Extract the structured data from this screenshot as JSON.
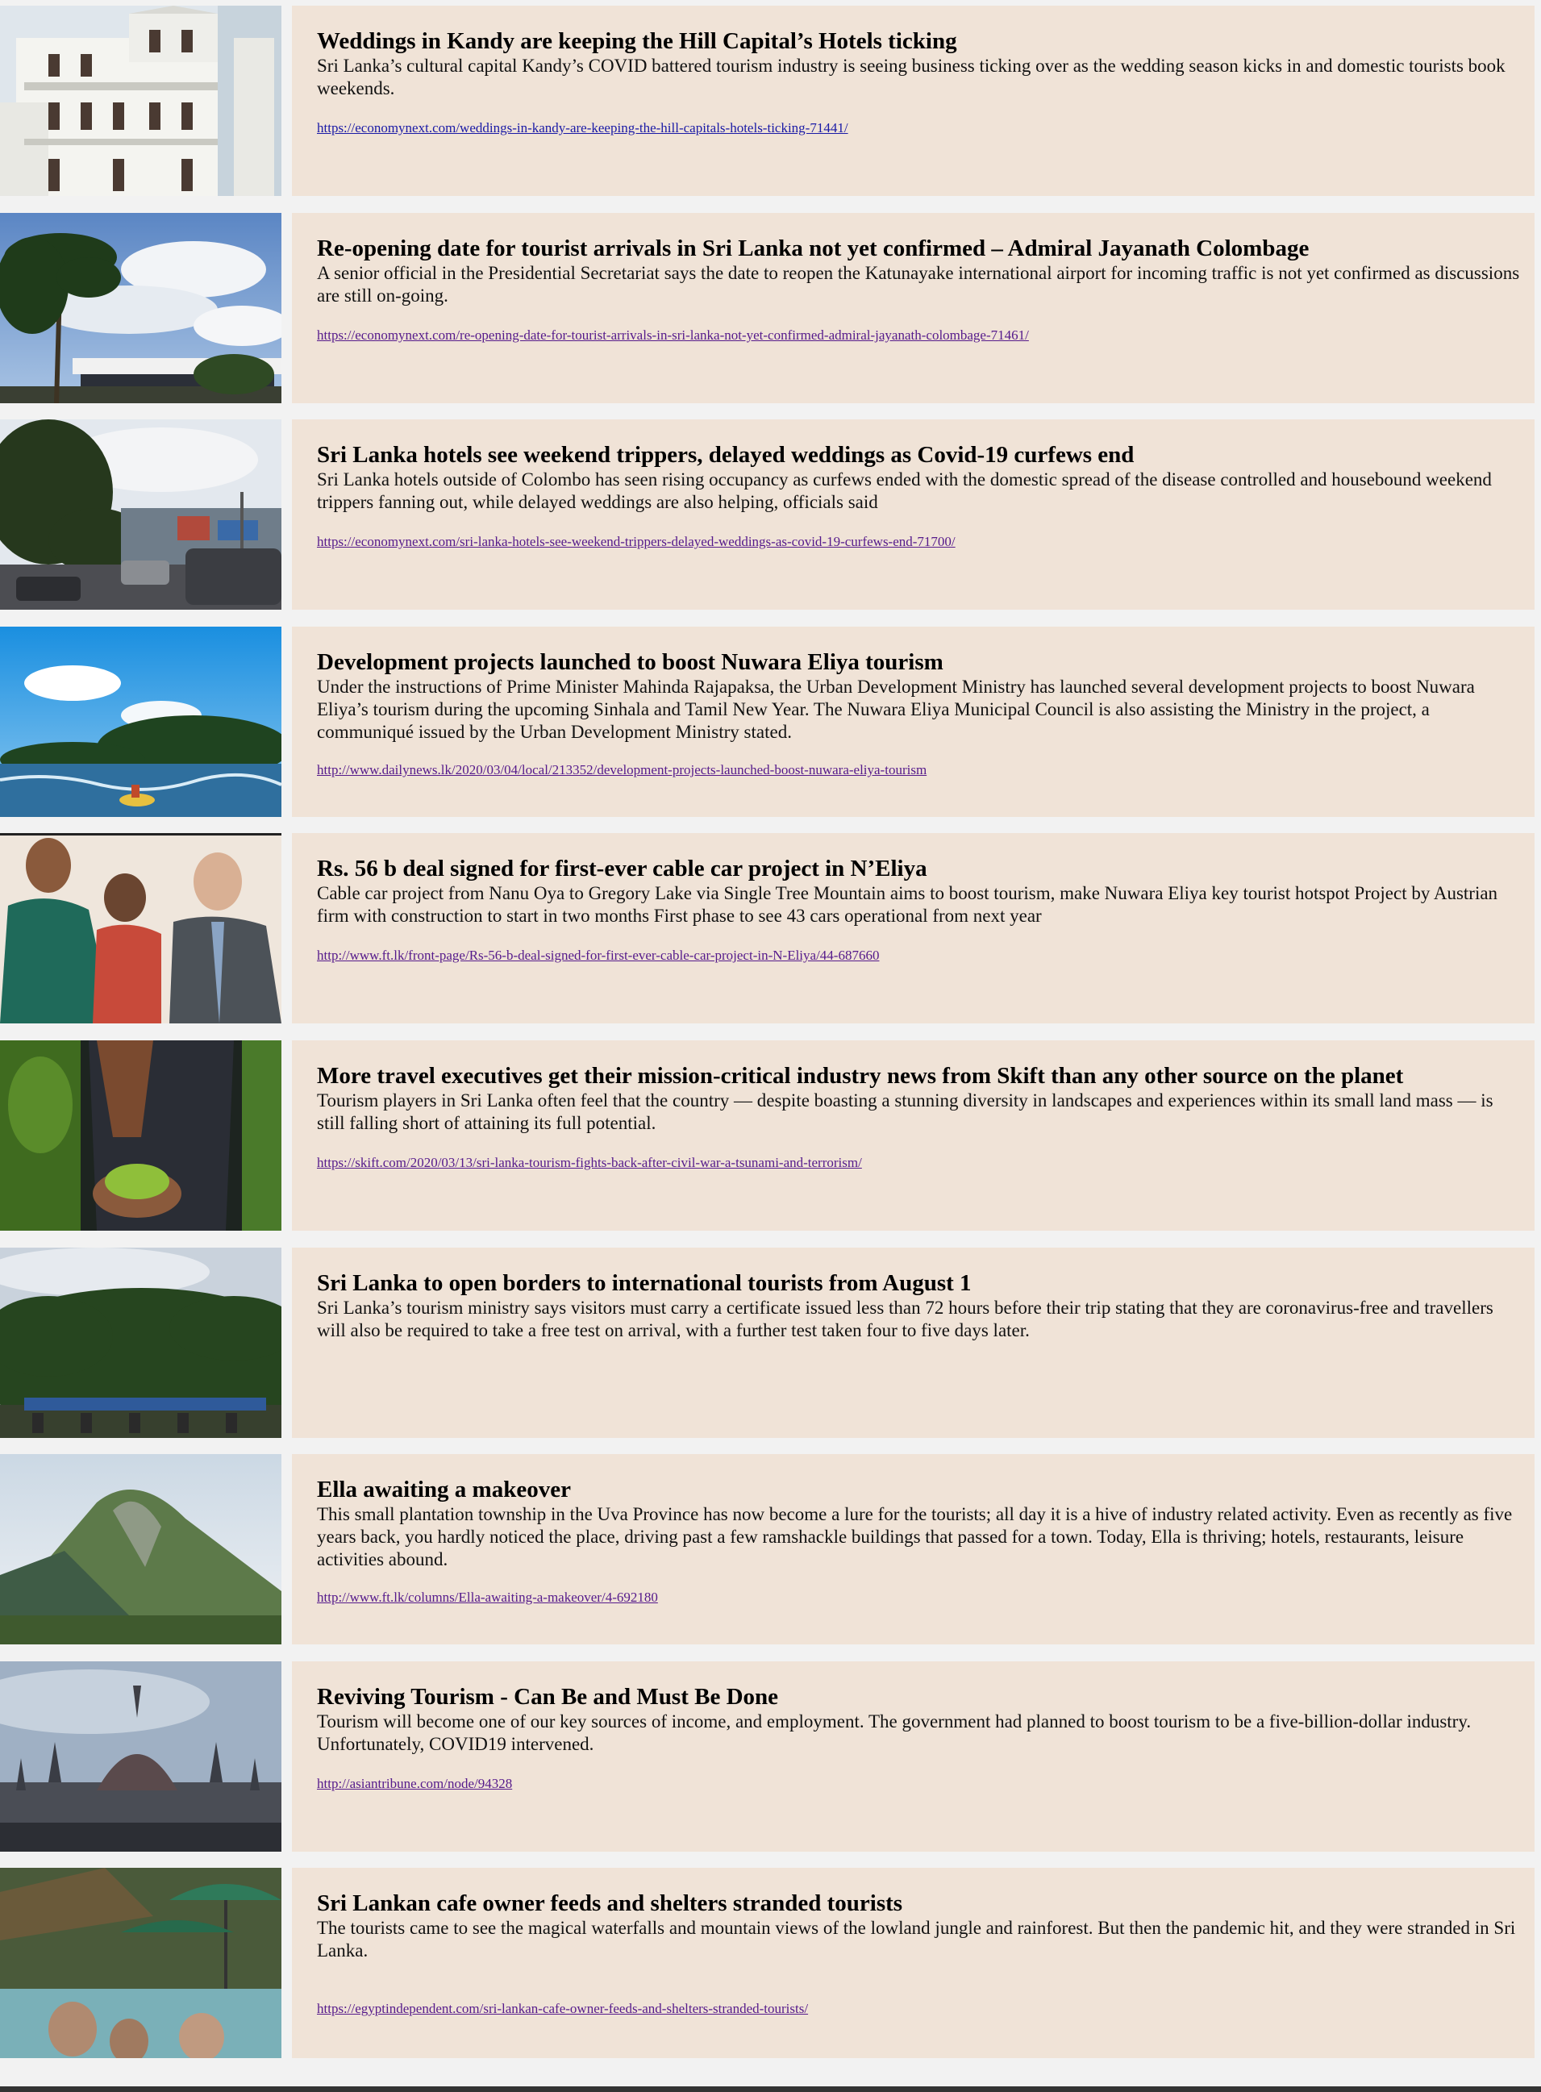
{
  "articles": [
    {
      "image": "kandy-colonial-hotel-building",
      "title": "Weddings in Kandy are keeping the Hill Capital’s Hotels ticking",
      "summary": "Sri Lanka’s cultural capital Kandy’s COVID battered tourism industry is seeing business ticking over as the wedding season kicks in and domestic tourists book weekends.",
      "url": "https://economynext.com/weddings-in-kandy-are-keeping-the-hill-capitals-hotels-ticking-71441/"
    },
    {
      "image": "airport-terminal-with-palm-trees",
      "title": "Re-opening date for tourist arrivals in Sri Lanka not yet confirmed – Admiral Jayanath Colombage",
      "summary": "A senior official in the Presidential Secretariat says the date to reopen the Katunayake international airport for incoming traffic is not yet confirmed as discussions are still on-going.",
      "url": "https://economynext.com/re-opening-date-for-tourist-arrivals-in-sri-lanka-not-yet-confirmed-admiral-jayanath-colombage-71461/"
    },
    {
      "image": "town-street-with-traffic",
      "title": "Sri Lanka hotels see weekend trippers, delayed weddings as Covid-19 curfews end",
      "summary": "Sri Lanka hotels outside of Colombo has seen rising occupancy as curfews ended with the domestic spread of the disease controlled and housebound weekend trippers fanning out, while delayed weddings are also helping, officials said",
      "url": "https://economynext.com/sri-lanka-hotels-see-weekend-trippers-delayed-weddings-as-covid-19-curfews-end-71700/"
    },
    {
      "image": "lake-with-jet-ski",
      "title": "Development projects launched to boost Nuwara Eliya tourism",
      "summary": "Under the instructions of Prime Minister Mahinda Rajapaksa, the Urban Development Ministry has launched several development projects to boost Nuwara Eliya’s tourism during the upcoming Sinhala and Tamil New Year. The Nuwara Eliya Municipal Council is also assisting the Ministry in the project, a communiqué issued by the Urban Development Ministry stated.",
      "url": "http://www.dailynews.lk/2020/03/04/local/213352/development-projects-launched-boost-nuwara-eliya-tourism"
    },
    {
      "image": "officials-shaking-hands",
      "title": "Rs. 56 b deal signed for first-ever cable car project in N’Eliya",
      "summary": "Cable car project from Nanu Oya to Gregory Lake via Single Tree Mountain aims to boost tourism, make Nuwara Eliya key tourist hotspot Project by Austrian firm with construction to start in two months First phase to see 43 cars operational from next year",
      "url": "http://www.ft.lk/front-page/Rs-56-b-deal-signed-for-first-ever-cable-car-project-in-N-Eliya/44-687660"
    },
    {
      "image": "hands-holding-tea-leaves",
      "title": "More travel executives get their mission-critical industry news from Skift than any other source on the planet",
      "summary": "Tourism players in Sri Lanka often feel that the country — despite boasting a stunning diversity in landscapes and experiences within its small land mass — is still falling short of attaining its full potential.",
      "url": "https://skift.com/2020/03/13/sri-lanka-tourism-fights-back-after-civil-war-a-tsunami-and-terrorism/"
    },
    {
      "image": "train-on-bridge-in-forest",
      "title": "Sri Lanka to open borders to international tourists from August 1",
      "summary": "Sri Lanka’s tourism ministry says visitors must carry a certificate issued less than 72 hours before their trip stating that they are coronavirus-free and travellers will also be required to take a free test on arrival, with a further test taken four to five days later.",
      "url": ""
    },
    {
      "image": "ella-rock-mountain",
      "title": "Ella awaiting a makeover",
      "summary": "This small plantation township in the Uva Province has now become a lure for the tourists; all day it is a hive of industry related activity. Even as recently as five years back, you hardly noticed the place, driving past a few ramshackle buildings that passed for a town. Today, Ella is thriving; hotels, restaurants, leisure activities abound.",
      "url": "http://www.ft.lk/columns/Ella-awaiting-a-makeover/4-692180"
    },
    {
      "image": "gothic-parliament-building",
      "title": "Reviving Tourism - Can Be and Must Be Done",
      "summary": "Tourism will become one of our key sources of income, and employment. The government had planned to boost tourism to be a five-billion-dollar industry. Unfortunately, COVID19 intervened.",
      "url": "http://asiantribune.com/node/94328"
    },
    {
      "image": "cafe-pool-with-umbrellas",
      "title": "Sri Lankan cafe owner feeds and shelters stranded tourists",
      "summary": "The tourists came to see the magical waterfalls and mountain views of the lowland jungle and rainforest. But then the pandemic hit, and they were stranded in Sri Lanka.",
      "url": "https://egyptindependent.com/sri-lankan-cafe-owner-feeds-and-shelters-stranded-tourists/"
    }
  ],
  "colors": {
    "card_background": "#f0e3d7",
    "page_background": "#f2f2f2",
    "link_visited": "#551a8b",
    "link_unvisited": "#1a1aa6"
  }
}
